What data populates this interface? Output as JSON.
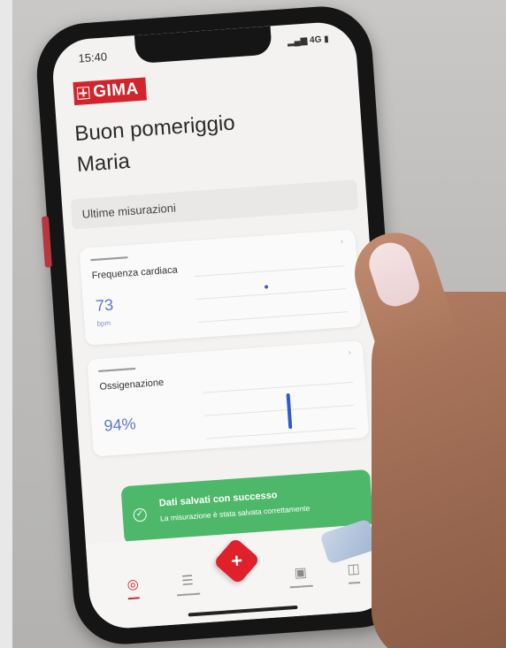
{
  "status_bar": {
    "time": "15:40",
    "signal_text": "4G"
  },
  "brand": {
    "logo_text": "GIMA"
  },
  "greeting": {
    "line1": "Buon pomeriggio",
    "line2": "Maria"
  },
  "section": {
    "title": "Ultime misurazioni"
  },
  "cards": [
    {
      "title": "Frequenza cardiaca",
      "value": "73",
      "unit": "bpm"
    },
    {
      "title": "Ossigenazione",
      "value": "94%",
      "unit": ""
    }
  ],
  "toast": {
    "title": "Dati salvati con successo",
    "message": "La misurazione è stata salvata correttamente",
    "icon": "check-circle-icon"
  },
  "colors": {
    "brand_red": "#d3242c",
    "toast_green": "#4eb86a",
    "value_blue": "#5b79cc"
  }
}
